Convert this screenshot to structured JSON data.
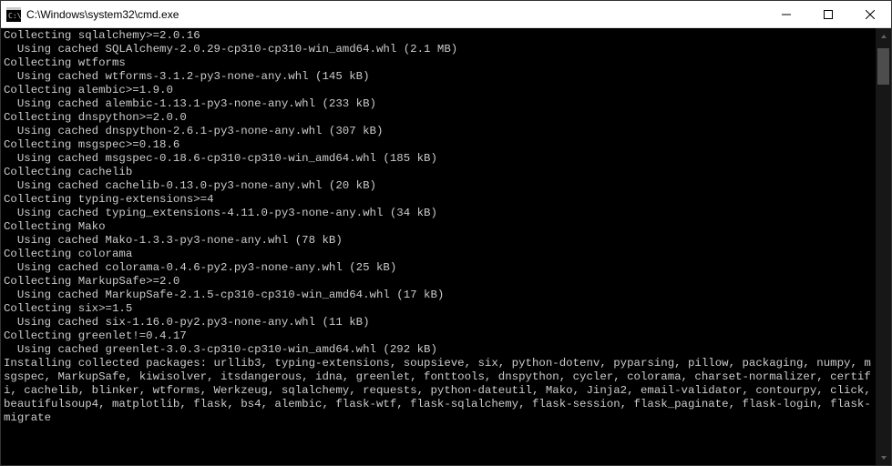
{
  "window": {
    "title": "C:\\Windows\\system32\\cmd.exe"
  },
  "terminal": {
    "lines": [
      "Collecting sqlalchemy>=2.0.16",
      "  Using cached SQLAlchemy-2.0.29-cp310-cp310-win_amd64.whl (2.1 MB)",
      "Collecting wtforms",
      "  Using cached wtforms-3.1.2-py3-none-any.whl (145 kB)",
      "Collecting alembic>=1.9.0",
      "  Using cached alembic-1.13.1-py3-none-any.whl (233 kB)",
      "Collecting dnspython>=2.0.0",
      "  Using cached dnspython-2.6.1-py3-none-any.whl (307 kB)",
      "Collecting msgspec>=0.18.6",
      "  Using cached msgspec-0.18.6-cp310-cp310-win_amd64.whl (185 kB)",
      "Collecting cachelib",
      "  Using cached cachelib-0.13.0-py3-none-any.whl (20 kB)",
      "Collecting typing-extensions>=4",
      "  Using cached typing_extensions-4.11.0-py3-none-any.whl (34 kB)",
      "Collecting Mako",
      "  Using cached Mako-1.3.3-py3-none-any.whl (78 kB)",
      "Collecting colorama",
      "  Using cached colorama-0.4.6-py2.py3-none-any.whl (25 kB)",
      "Collecting MarkupSafe>=2.0",
      "  Using cached MarkupSafe-2.1.5-cp310-cp310-win_amd64.whl (17 kB)",
      "Collecting six>=1.5",
      "  Using cached six-1.16.0-py2.py3-none-any.whl (11 kB)",
      "Collecting greenlet!=0.4.17",
      "  Using cached greenlet-3.0.3-cp310-cp310-win_amd64.whl (292 kB)",
      "Installing collected packages: urllib3, typing-extensions, soupsieve, six, python-dotenv, pyparsing, pillow, packaging, numpy, msgspec, MarkupSafe, kiwisolver, itsdangerous, idna, greenlet, fonttools, dnspython, cycler, colorama, charset-normalizer, certifi, cachelib, blinker, wtforms, Werkzeug, sqlalchemy, requests, python-dateutil, Mako, Jinja2, email-validator, contourpy, click, beautifulsoup4, matplotlib, flask, bs4, alembic, flask-wtf, flask-sqlalchemy, flask-session, flask_paginate, flask-login, flask-migrate"
    ]
  }
}
